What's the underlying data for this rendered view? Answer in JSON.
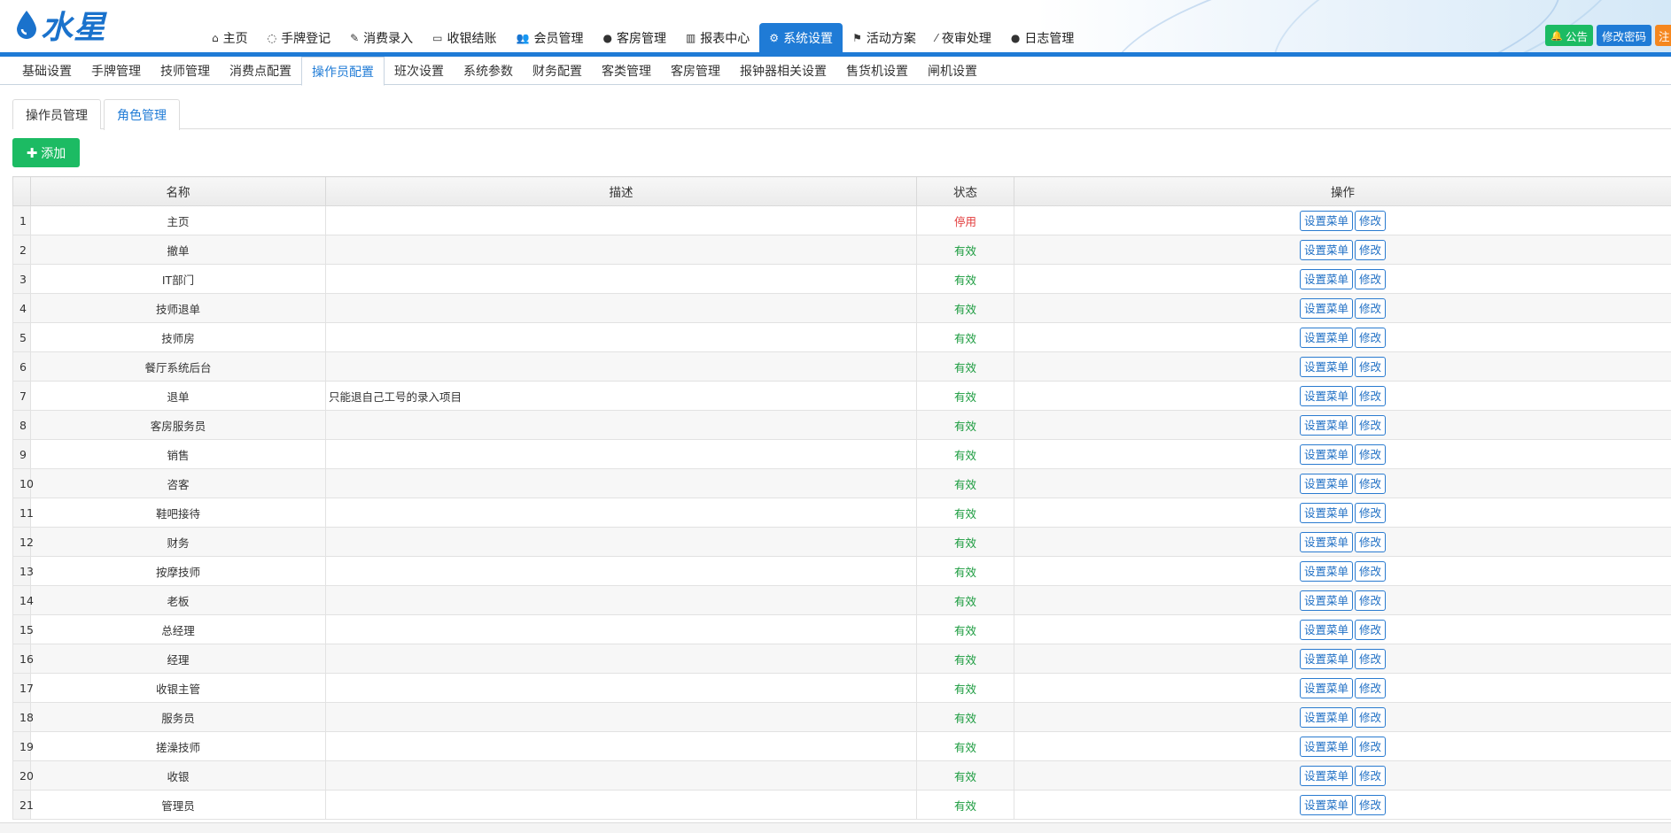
{
  "app": {
    "brand": "水星"
  },
  "nav": {
    "items": [
      {
        "label": "主页",
        "icon": "home-icon",
        "glyph": "⌂"
      },
      {
        "label": "手牌登记",
        "icon": "circle-icon",
        "glyph": "◌"
      },
      {
        "label": "消费录入",
        "icon": "edit-icon",
        "glyph": "✎"
      },
      {
        "label": "收银结账",
        "icon": "card-icon",
        "glyph": "▭"
      },
      {
        "label": "会员管理",
        "icon": "users-icon",
        "glyph": "👥"
      },
      {
        "label": "客房管理",
        "icon": "user-icon",
        "glyph": "●"
      },
      {
        "label": "报表中心",
        "icon": "bar-chart-icon",
        "glyph": "▥"
      },
      {
        "label": "系统设置",
        "icon": "gear-icon",
        "glyph": "⚙"
      },
      {
        "label": "活动方案",
        "icon": "flag-icon",
        "glyph": "⚑"
      },
      {
        "label": "夜审处理",
        "icon": "wand-icon",
        "glyph": "⁄"
      },
      {
        "label": "日志管理",
        "icon": "user-icon",
        "glyph": "●"
      }
    ],
    "active_index": 7
  },
  "header_buttons": {
    "notice": "公告",
    "change_password": "修改密码",
    "logout": "注"
  },
  "subnav": {
    "items": [
      "基础设置",
      "手牌管理",
      "技师管理",
      "消费点配置",
      "操作员配置",
      "班次设置",
      "系统参数",
      "财务配置",
      "客类管理",
      "客房管理",
      "报钟器相关设置",
      "售货机设置",
      "闸机设置"
    ],
    "active_index": 4
  },
  "tabs": {
    "items": [
      "操作员管理",
      "角色管理"
    ],
    "active_index": 1
  },
  "add_button": "添加",
  "table": {
    "columns": [
      "名称",
      "描述",
      "状态",
      "操作"
    ],
    "set_menu_label": "设置菜单",
    "edit_label": "修改",
    "rows": [
      {
        "no": "1",
        "name": "主页",
        "desc": "",
        "status": "停用"
      },
      {
        "no": "2",
        "name": "撤单",
        "desc": "",
        "status": "有效"
      },
      {
        "no": "3",
        "name": "IT部门",
        "desc": "",
        "status": "有效"
      },
      {
        "no": "4",
        "name": "技师退单",
        "desc": "",
        "status": "有效"
      },
      {
        "no": "5",
        "name": "技师房",
        "desc": "",
        "status": "有效"
      },
      {
        "no": "6",
        "name": "餐厅系统后台",
        "desc": "",
        "status": "有效"
      },
      {
        "no": "7",
        "name": "退单",
        "desc": "只能退自己工号的录入项目",
        "status": "有效"
      },
      {
        "no": "8",
        "name": "客房服务员",
        "desc": "",
        "status": "有效"
      },
      {
        "no": "9",
        "name": "销售",
        "desc": "",
        "status": "有效"
      },
      {
        "no": "10",
        "name": "咨客",
        "desc": "",
        "status": "有效"
      },
      {
        "no": "11",
        "name": "鞋吧接待",
        "desc": "",
        "status": "有效"
      },
      {
        "no": "12",
        "name": "财务",
        "desc": "",
        "status": "有效"
      },
      {
        "no": "13",
        "name": "按摩技师",
        "desc": "",
        "status": "有效"
      },
      {
        "no": "14",
        "name": "老板",
        "desc": "",
        "status": "有效"
      },
      {
        "no": "15",
        "name": "总经理",
        "desc": "",
        "status": "有效"
      },
      {
        "no": "16",
        "name": "经理",
        "desc": "",
        "status": "有效"
      },
      {
        "no": "17",
        "name": "收银主管",
        "desc": "",
        "status": "有效"
      },
      {
        "no": "18",
        "name": "服务员",
        "desc": "",
        "status": "有效"
      },
      {
        "no": "19",
        "name": "搓澡技师",
        "desc": "",
        "status": "有效"
      },
      {
        "no": "20",
        "name": "收银",
        "desc": "",
        "status": "有效"
      },
      {
        "no": "21",
        "name": "管理员",
        "desc": "",
        "status": "有效"
      }
    ]
  },
  "colors": {
    "primary": "#1f7bd6",
    "success": "#1cbb63",
    "status_ok": "#1a9b3e",
    "status_off": "#e23a3a",
    "orange": "#f5871f"
  }
}
